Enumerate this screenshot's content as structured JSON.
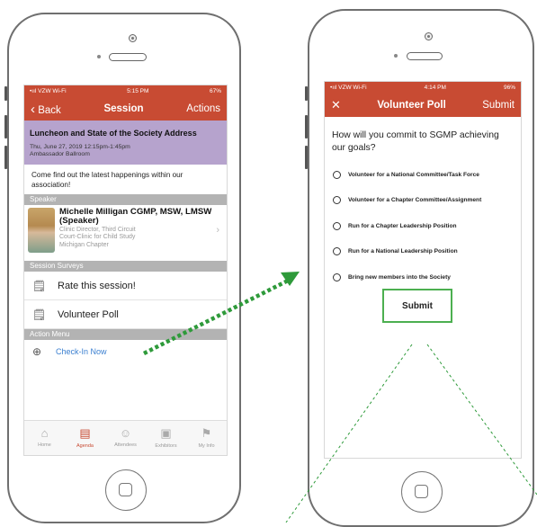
{
  "left_phone": {
    "status_bar": {
      "carrier": "•ııl VZW Wi-Fi",
      "time": "5:15 PM",
      "battery": "67%"
    },
    "nav": {
      "back": "Back",
      "title": "Session",
      "actions": "Actions"
    },
    "event": {
      "title": "Luncheon and State of the Society Address",
      "date": "Thu, June 27, 2019 12:15pm-1:45pm",
      "location": "Ambassador Ballroom",
      "description": "Come find out the latest happenings within our association!"
    },
    "speaker_header": "Speaker",
    "speaker": {
      "name": "Michelle Milligan CGMP, MSW, LMSW (Speaker)",
      "line1": "Clinic Director, Third Circuit",
      "line2": "Court-Clinic for Child Study",
      "line3": "Michigan Chapter"
    },
    "surveys_header": "Session Surveys",
    "surveys": [
      "Rate this session!",
      "Volunteer Poll"
    ],
    "action_header": "Action Menu",
    "actions": [
      "Check-In Now"
    ],
    "tabs": [
      {
        "label": "Home",
        "icon": "home-icon",
        "active": false
      },
      {
        "label": "Agenda",
        "icon": "agenda-icon",
        "active": true
      },
      {
        "label": "Attendees",
        "icon": "attendees-icon",
        "active": false
      },
      {
        "label": "Exhibitors",
        "icon": "exhibitors-icon",
        "active": false
      },
      {
        "label": "My Info",
        "icon": "flag-icon",
        "active": false
      }
    ]
  },
  "right_phone": {
    "status_bar": {
      "carrier": "•ııl VZW Wi-Fi",
      "time": "4:14 PM",
      "battery": "96%"
    },
    "nav": {
      "close": "✕",
      "title": "Volunteer Poll",
      "submit": "Submit"
    },
    "question": "How will you commit to SGMP achieving our goals?",
    "options": [
      "Volunteer for a National Committee/Task Force",
      "Volunteer for a Chapter Committee/Assignment",
      "Run for a Chapter Leadership Position",
      "Run for a National Leadership Position",
      "Bring new members into the Society"
    ],
    "submit_button": "Submit"
  },
  "colors": {
    "header_red": "#c84b33",
    "event_purple": "#b6a3cd",
    "highlight_green": "#4caf50",
    "link_blue": "#3a7fd0"
  }
}
